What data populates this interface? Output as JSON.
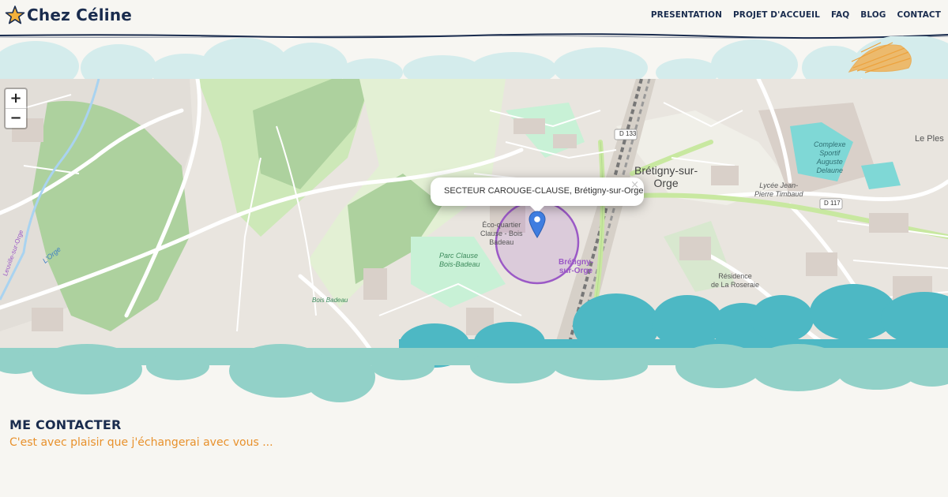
{
  "header": {
    "logo_text": "Chez Céline",
    "nav": [
      "PRESENTATION",
      "PROJET D'ACCUEIL",
      "FAQ",
      "BLOG",
      "CONTACT"
    ]
  },
  "map": {
    "zoom_in": "+",
    "zoom_out": "−",
    "popup_text": "SECTEUR CAROUGE-CLAUSE, Brétigny-sur-Orge",
    "popup_close": "×",
    "labels": {
      "town": "Brétigny-sur-\nOrge",
      "d133": "D 133",
      "d117": "D 117",
      "complexe": "Complexe\nSportif\nAuguste\nDelaune",
      "lycee": "Lycée Jean-\nPierre Timbaud",
      "eco": "Éco-quartier\nClause - Bois\nBadeau",
      "parc": "Parc Clause\nBois-Badeau",
      "bois_badeau": "Bois Badeau",
      "bretigny_purple": "Brétigny-\nsur-Orge",
      "residence": "Résidence\nde La Roseraie",
      "le_ples": "Le Ples",
      "leuville": "Leuville-sur-Orge",
      "lorge": "L'Orge"
    },
    "colors": {
      "marker": "#3f7de0",
      "circle": "#9b59c6"
    }
  },
  "contact": {
    "title": "ME CONTACTER",
    "subtitle": "C'est avec plaisir que j'échangerai avec vous ..."
  },
  "colors": {
    "navy": "#1a2c4e",
    "orange": "#e8912c",
    "cloud_light": "#d4ecec",
    "cloud_teal": "#4db8c4",
    "cloud_mint": "#92d1c8"
  }
}
